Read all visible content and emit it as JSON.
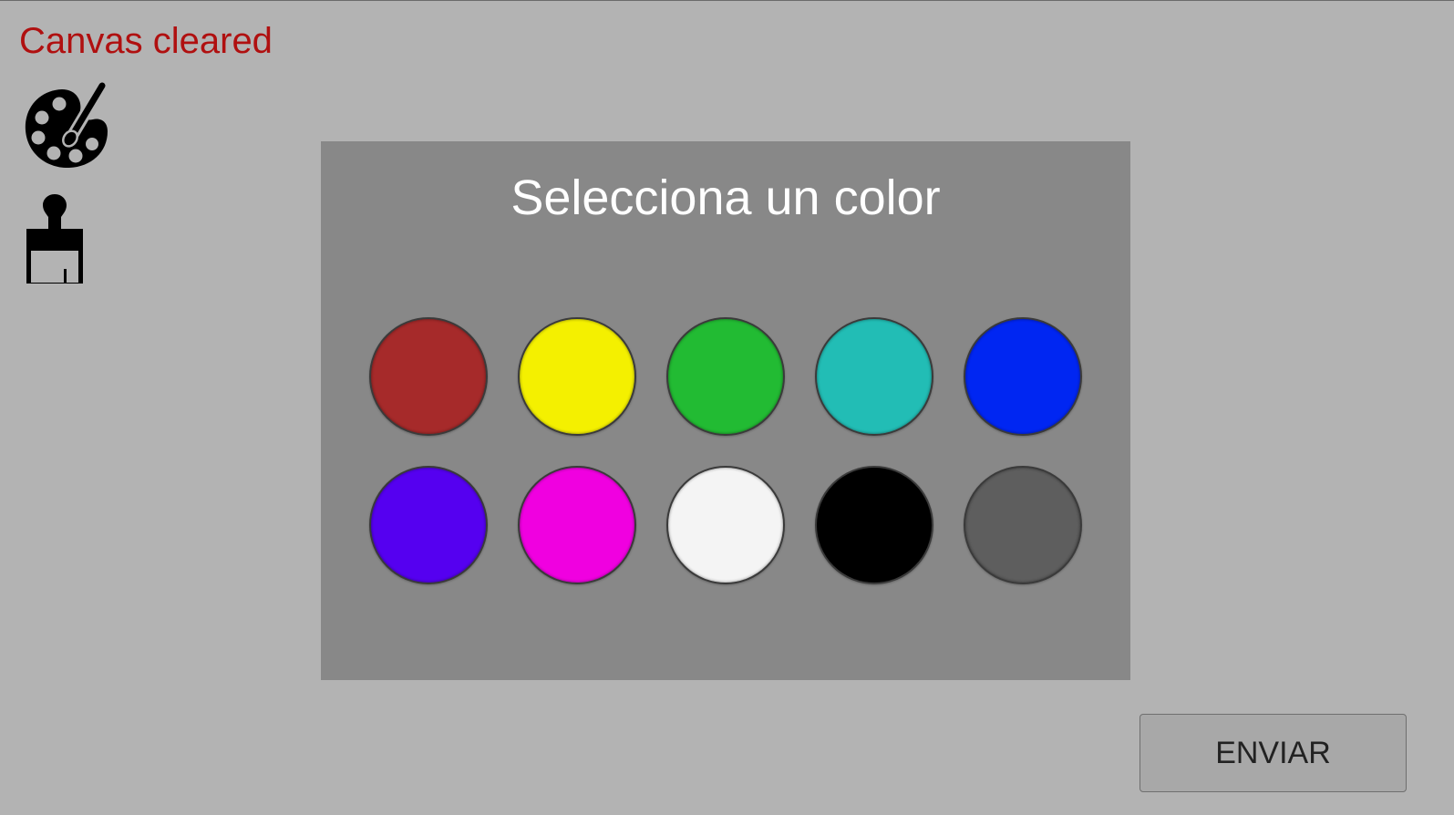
{
  "status": {
    "message": "Canvas cleared",
    "color": "#b01010"
  },
  "toolbar": {
    "tools": [
      {
        "icon": "palette-icon"
      },
      {
        "icon": "paint-brush-icon"
      }
    ]
  },
  "color_dialog": {
    "title": "Selecciona un color",
    "swatches": [
      {
        "color": "#a62a2a"
      },
      {
        "color": "#f4f000"
      },
      {
        "color": "#22bb33"
      },
      {
        "color": "#22bdb5"
      },
      {
        "color": "#0026f2"
      },
      {
        "color": "#5500f0"
      },
      {
        "color": "#f000e0"
      },
      {
        "color": "#f4f4f4"
      },
      {
        "color": "#000000"
      },
      {
        "color": "#5e5e5e"
      }
    ]
  },
  "footer": {
    "send_label": "ENVIAR"
  }
}
